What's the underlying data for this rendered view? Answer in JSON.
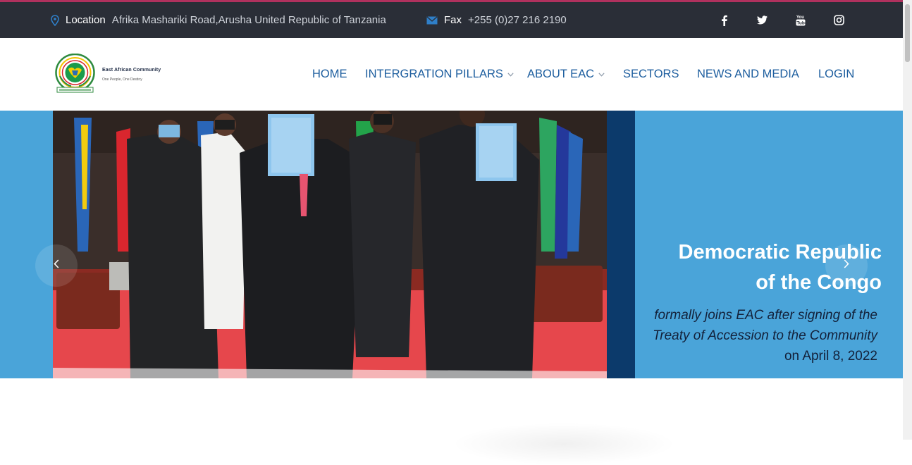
{
  "topbar": {
    "location_label": "Location",
    "location_value": "Afrika Mashariki Road,Arusha United Republic of Tanzania",
    "fax_label": "Fax",
    "fax_value": "+255 (0)27 216 2190",
    "social_icons": [
      "facebook-icon",
      "twitter-icon",
      "youtube-icon",
      "instagram-icon"
    ]
  },
  "header": {
    "logo_name": "East African Community",
    "logo_tagline": "One People, One Destiny"
  },
  "nav": {
    "items": [
      {
        "label": "HOME"
      },
      {
        "label": "INTERGRATION PILLARS"
      },
      {
        "label": "ABOUT EAC"
      },
      {
        "label": "SECTORS"
      },
      {
        "label": "NEWS AND MEDIA"
      },
      {
        "label": "LOGIN"
      }
    ]
  },
  "slide": {
    "title_line1": "Democratic Republic",
    "title_line2": "of the Congo",
    "desc_italic": "formally joins EAC after signing of the Treaty of Accession to the Community",
    "desc_tail": " on April 8, 2022"
  },
  "colors": {
    "topbar_bg": "#2a2e37",
    "accent": "#b0315e",
    "nav_link": "#1c5d9e",
    "slide_bg": "#4aa4d9",
    "slide_band": "#0c3a6b"
  }
}
